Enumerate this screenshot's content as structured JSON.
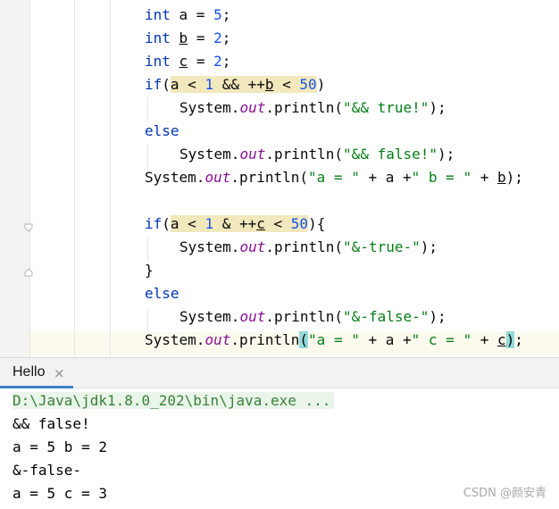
{
  "editor": {
    "lines": [
      {
        "tokens": [
          {
            "t": "int",
            "c": "kw"
          },
          {
            "t": " a = "
          },
          {
            "t": "5",
            "c": "num"
          },
          {
            "t": ";"
          }
        ]
      },
      {
        "tokens": [
          {
            "t": "int",
            "c": "kw"
          },
          {
            "t": " "
          },
          {
            "t": "b",
            "c": "und"
          },
          {
            "t": " = "
          },
          {
            "t": "2",
            "c": "num"
          },
          {
            "t": ";"
          }
        ]
      },
      {
        "tokens": [
          {
            "t": "int",
            "c": "kw"
          },
          {
            "t": " "
          },
          {
            "t": "c",
            "c": "und"
          },
          {
            "t": " = "
          },
          {
            "t": "2",
            "c": "num"
          },
          {
            "t": ";"
          }
        ]
      },
      {
        "tokens": [
          {
            "t": "if",
            "c": "kw"
          },
          {
            "t": "("
          },
          {
            "t": "a < ",
            "c": "hl"
          },
          {
            "t": "1",
            "c": "num hl"
          },
          {
            "t": " && ++",
            "c": "hl"
          },
          {
            "t": "b",
            "c": "und hl"
          },
          {
            "t": " < ",
            "c": "hl"
          },
          {
            "t": "50",
            "c": "num hl"
          },
          {
            "t": ")"
          }
        ]
      },
      {
        "indent": true,
        "tokens": [
          {
            "t": "System."
          },
          {
            "t": "out",
            "c": "fld"
          },
          {
            "t": ".println("
          },
          {
            "t": "\"&& true!\"",
            "c": "str"
          },
          {
            "t": ");"
          }
        ]
      },
      {
        "tokens": [
          {
            "t": "else",
            "c": "kw"
          }
        ]
      },
      {
        "indent": true,
        "tokens": [
          {
            "t": "System."
          },
          {
            "t": "out",
            "c": "fld"
          },
          {
            "t": ".println("
          },
          {
            "t": "\"&& false!\"",
            "c": "str"
          },
          {
            "t": ");"
          }
        ]
      },
      {
        "tokens": [
          {
            "t": "System."
          },
          {
            "t": "out",
            "c": "fld"
          },
          {
            "t": ".println("
          },
          {
            "t": "\"a = \"",
            "c": "str"
          },
          {
            "t": " + a +"
          },
          {
            "t": "\" b = \"",
            "c": "str"
          },
          {
            "t": " + "
          },
          {
            "t": "b",
            "c": "und"
          },
          {
            "t": ");"
          }
        ]
      },
      {
        "tokens": []
      },
      {
        "tokens": [
          {
            "t": "if",
            "c": "kw"
          },
          {
            "t": "("
          },
          {
            "t": "a < ",
            "c": "hl"
          },
          {
            "t": "1",
            "c": "num hl"
          },
          {
            "t": " & ++",
            "c": "hl"
          },
          {
            "t": "c",
            "c": "und hl"
          },
          {
            "t": " < ",
            "c": "hl"
          },
          {
            "t": "50",
            "c": "num hl"
          },
          {
            "t": "){"
          }
        ]
      },
      {
        "indent": true,
        "tokens": [
          {
            "t": "System."
          },
          {
            "t": "out",
            "c": "fld"
          },
          {
            "t": ".println("
          },
          {
            "t": "\"&-true-\"",
            "c": "str"
          },
          {
            "t": ");"
          }
        ]
      },
      {
        "tokens": [
          {
            "t": "}"
          }
        ]
      },
      {
        "tokens": [
          {
            "t": "else",
            "c": "kw"
          }
        ]
      },
      {
        "indent": true,
        "tokens": [
          {
            "t": "System."
          },
          {
            "t": "out",
            "c": "fld"
          },
          {
            "t": ".println("
          },
          {
            "t": "\"&-false-\"",
            "c": "str"
          },
          {
            "t": ");"
          }
        ]
      },
      {
        "tokens": [
          {
            "t": "System."
          },
          {
            "t": "out",
            "c": "fld"
          },
          {
            "t": ".println"
          },
          {
            "t": "(",
            "c": "brace"
          },
          {
            "t": "\"a = \"",
            "c": "str"
          },
          {
            "t": " + a +"
          },
          {
            "t": "\" c = \"",
            "c": "str"
          },
          {
            "t": " + "
          },
          {
            "t": "c",
            "c": "und"
          },
          {
            "t": ")",
            "c": "brace"
          },
          {
            "t": ";"
          }
        ]
      }
    ]
  },
  "run_panel": {
    "tab_label": "Hello",
    "close_glyph": "×",
    "command": "D:\\Java\\jdk1.8.0_202\\bin\\java.exe ...",
    "output": [
      "&& false!",
      "a = 5 b = 2",
      "&-false-",
      "a = 5 c = 3"
    ]
  },
  "watermark": "CSDN @颜安青"
}
